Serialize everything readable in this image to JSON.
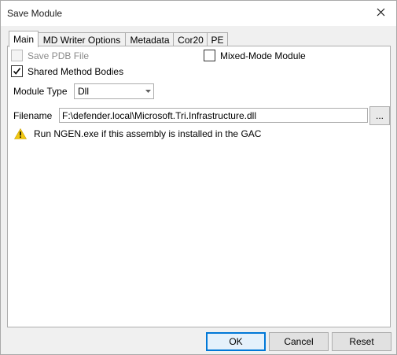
{
  "window": {
    "title": "Save Module",
    "close_glyph": "✕"
  },
  "tabs": [
    {
      "label": "Main",
      "active": true
    },
    {
      "label": "MD Writer Options",
      "active": false
    },
    {
      "label": "Metadata",
      "active": false
    },
    {
      "label": "Cor20",
      "active": false
    },
    {
      "label": "PE",
      "active": false
    }
  ],
  "main": {
    "save_pdb": {
      "label": "Save PDB File",
      "checked": false,
      "enabled": false
    },
    "mixed_mode": {
      "label": "Mixed-Mode Module",
      "checked": false,
      "enabled": true
    },
    "shared_bodies": {
      "label": "Shared Method Bodies",
      "checked": true,
      "enabled": true,
      "check_glyph": "✔"
    },
    "module_type": {
      "label": "Module Type",
      "value": "Dll"
    },
    "filename": {
      "label": "Filename",
      "value": "F:\\defender.local\\Microsoft.Tri.Infrastructure.dll",
      "browse_label": "..."
    },
    "warning": {
      "text": "Run NGEN.exe if this assembly is installed in the GAC",
      "icon": "warning-icon",
      "icon_color": "#f2c811"
    }
  },
  "buttons": {
    "ok": "OK",
    "cancel": "Cancel",
    "reset": "Reset"
  }
}
